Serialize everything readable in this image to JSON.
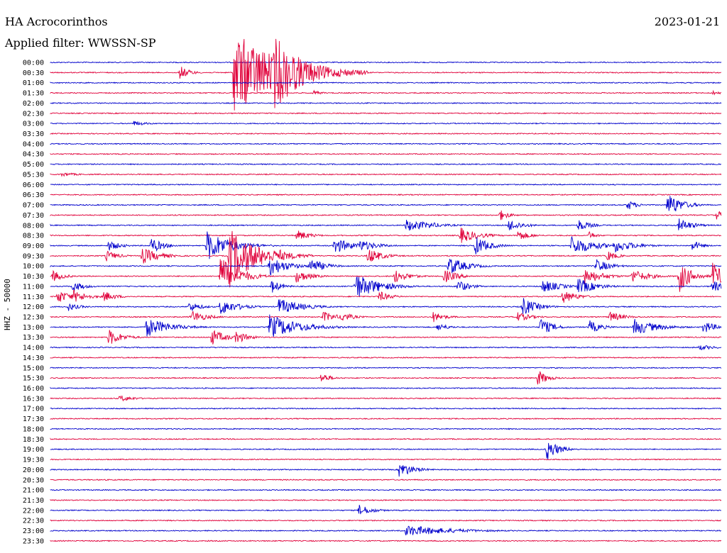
{
  "header": {
    "station": "HA Acrocorinthos",
    "date": "2023-01-21",
    "filter": "Applied filter: WWSSN-SP"
  },
  "chart_data": {
    "type": "helicorder",
    "ylabel": "HHZ - 50000",
    "colors": [
      "#0000cc",
      "#e0003a"
    ],
    "rows": [
      "00:00",
      "00:30",
      "01:00",
      "01:30",
      "02:00",
      "02:30",
      "03:00",
      "03:30",
      "04:00",
      "04:30",
      "05:00",
      "05:30",
      "06:00",
      "06:30",
      "07:00",
      "07:30",
      "08:00",
      "08:30",
      "09:00",
      "09:30",
      "10:00",
      "10:30",
      "11:00",
      "11:30",
      "12:00",
      "12:30",
      "13:00",
      "13:30",
      "14:00",
      "14:30",
      "15:00",
      "15:30",
      "16:00",
      "16:30",
      "17:00",
      "17:30",
      "18:00",
      "18:30",
      "19:00",
      "19:30",
      "20:00",
      "20:30",
      "21:00",
      "21:30",
      "22:00",
      "22:30",
      "23:00",
      "23:30"
    ],
    "minutes_per_row": 30,
    "events": [
      {
        "row": 1,
        "minute": 5.8,
        "amp": 10,
        "dur": 0.8
      },
      {
        "row": 1,
        "minute": 8.2,
        "amp": 60,
        "dur": 4.0
      },
      {
        "row": 1,
        "minute": 10.0,
        "amp": 55,
        "dur": 2.5
      },
      {
        "row": 3,
        "minute": 11.7,
        "amp": 4,
        "dur": 0.8
      },
      {
        "row": 3,
        "minute": 29.6,
        "amp": 3,
        "dur": 1.0
      },
      {
        "row": 6,
        "minute": 3.7,
        "amp": 4,
        "dur": 1.2
      },
      {
        "row": 11,
        "minute": 0.5,
        "amp": 3,
        "dur": 1.5
      },
      {
        "row": 14,
        "minute": 25.8,
        "amp": 8,
        "dur": 0.8
      },
      {
        "row": 14,
        "minute": 27.6,
        "amp": 18,
        "dur": 1.2
      },
      {
        "row": 15,
        "minute": 20.1,
        "amp": 8,
        "dur": 0.8
      },
      {
        "row": 15,
        "minute": 29.8,
        "amp": 8,
        "dur": 0.6
      },
      {
        "row": 16,
        "minute": 15.9,
        "amp": 9,
        "dur": 2.2
      },
      {
        "row": 16,
        "minute": 16.9,
        "amp": 5,
        "dur": 1.5
      },
      {
        "row": 16,
        "minute": 20.5,
        "amp": 9,
        "dur": 1.2
      },
      {
        "row": 16,
        "minute": 23.6,
        "amp": 9,
        "dur": 1.0
      },
      {
        "row": 16,
        "minute": 28.1,
        "amp": 10,
        "dur": 1.2
      },
      {
        "row": 17,
        "minute": 11.0,
        "amp": 8,
        "dur": 1.2
      },
      {
        "row": 17,
        "minute": 18.3,
        "amp": 12,
        "dur": 1.5
      },
      {
        "row": 17,
        "minute": 20.9,
        "amp": 8,
        "dur": 1.0
      },
      {
        "row": 17,
        "minute": 24.1,
        "amp": 6,
        "dur": 0.6
      },
      {
        "row": 18,
        "minute": 2.6,
        "amp": 8,
        "dur": 1.0
      },
      {
        "row": 18,
        "minute": 4.5,
        "amp": 12,
        "dur": 1.0
      },
      {
        "row": 18,
        "minute": 7.0,
        "amp": 22,
        "dur": 2.0
      },
      {
        "row": 18,
        "minute": 12.7,
        "amp": 12,
        "dur": 1.5
      },
      {
        "row": 18,
        "minute": 13.8,
        "amp": 9,
        "dur": 1.5
      },
      {
        "row": 18,
        "minute": 19.0,
        "amp": 14,
        "dur": 1.2
      },
      {
        "row": 18,
        "minute": 23.3,
        "amp": 14,
        "dur": 2.0
      },
      {
        "row": 18,
        "minute": 25.2,
        "amp": 10,
        "dur": 1.8
      },
      {
        "row": 18,
        "minute": 28.7,
        "amp": 8,
        "dur": 0.8
      },
      {
        "row": 19,
        "minute": 2.5,
        "amp": 8,
        "dur": 1.0
      },
      {
        "row": 19,
        "minute": 4.1,
        "amp": 12,
        "dur": 1.5
      },
      {
        "row": 19,
        "minute": 8.0,
        "amp": 40,
        "dur": 2.5
      },
      {
        "row": 19,
        "minute": 10.2,
        "amp": 10,
        "dur": 1.0
      },
      {
        "row": 19,
        "minute": 14.2,
        "amp": 12,
        "dur": 1.2
      },
      {
        "row": 19,
        "minute": 24.9,
        "amp": 8,
        "dur": 0.8
      },
      {
        "row": 20,
        "minute": 9.8,
        "amp": 15,
        "dur": 1.5
      },
      {
        "row": 20,
        "minute": 11.6,
        "amp": 12,
        "dur": 1.2
      },
      {
        "row": 20,
        "minute": 17.8,
        "amp": 14,
        "dur": 1.5
      },
      {
        "row": 20,
        "minute": 24.4,
        "amp": 10,
        "dur": 1.2
      },
      {
        "row": 21,
        "minute": 0.1,
        "amp": 8,
        "dur": 1.0
      },
      {
        "row": 21,
        "minute": 7.6,
        "amp": 30,
        "dur": 1.5
      },
      {
        "row": 21,
        "minute": 11.0,
        "amp": 10,
        "dur": 1.2
      },
      {
        "row": 21,
        "minute": 15.4,
        "amp": 10,
        "dur": 1.2
      },
      {
        "row": 21,
        "minute": 17.6,
        "amp": 10,
        "dur": 1.2
      },
      {
        "row": 21,
        "minute": 23.9,
        "amp": 12,
        "dur": 1.5
      },
      {
        "row": 21,
        "minute": 26.0,
        "amp": 10,
        "dur": 1.5
      },
      {
        "row": 21,
        "minute": 28.1,
        "amp": 25,
        "dur": 1.0
      },
      {
        "row": 21,
        "minute": 29.6,
        "amp": 20,
        "dur": 1.0
      },
      {
        "row": 22,
        "minute": 1.0,
        "amp": 8,
        "dur": 1.0
      },
      {
        "row": 22,
        "minute": 9.9,
        "amp": 10,
        "dur": 0.8
      },
      {
        "row": 22,
        "minute": 13.6,
        "amp": 20,
        "dur": 2.0
      },
      {
        "row": 22,
        "minute": 18.2,
        "amp": 10,
        "dur": 1.0
      },
      {
        "row": 22,
        "minute": 22.0,
        "amp": 10,
        "dur": 1.5
      },
      {
        "row": 22,
        "minute": 23.6,
        "amp": 12,
        "dur": 1.5
      },
      {
        "row": 22,
        "minute": 29.6,
        "amp": 10,
        "dur": 0.8
      },
      {
        "row": 23,
        "minute": 0.3,
        "amp": 10,
        "dur": 1.2
      },
      {
        "row": 23,
        "minute": 1.0,
        "amp": 10,
        "dur": 1.2
      },
      {
        "row": 23,
        "minute": 2.4,
        "amp": 8,
        "dur": 1.0
      },
      {
        "row": 23,
        "minute": 14.7,
        "amp": 8,
        "dur": 1.0
      },
      {
        "row": 23,
        "minute": 22.9,
        "amp": 10,
        "dur": 1.2
      },
      {
        "row": 24,
        "minute": 0.8,
        "amp": 6,
        "dur": 1.0
      },
      {
        "row": 24,
        "minute": 6.2,
        "amp": 8,
        "dur": 1.0
      },
      {
        "row": 24,
        "minute": 7.6,
        "amp": 12,
        "dur": 1.5
      },
      {
        "row": 24,
        "minute": 10.2,
        "amp": 12,
        "dur": 2.0
      },
      {
        "row": 24,
        "minute": 21.1,
        "amp": 14,
        "dur": 1.2
      },
      {
        "row": 25,
        "minute": 6.3,
        "amp": 10,
        "dur": 1.2
      },
      {
        "row": 25,
        "minute": 12.2,
        "amp": 8,
        "dur": 1.2
      },
      {
        "row": 25,
        "minute": 13.0,
        "amp": 8,
        "dur": 1.0
      },
      {
        "row": 25,
        "minute": 17.1,
        "amp": 8,
        "dur": 1.0
      },
      {
        "row": 25,
        "minute": 20.8,
        "amp": 8,
        "dur": 1.2
      },
      {
        "row": 25,
        "minute": 25.0,
        "amp": 8,
        "dur": 1.2
      },
      {
        "row": 26,
        "minute": 4.3,
        "amp": 14,
        "dur": 2.0
      },
      {
        "row": 26,
        "minute": 9.8,
        "amp": 18,
        "dur": 2.5
      },
      {
        "row": 26,
        "minute": 17.3,
        "amp": 6,
        "dur": 1.0
      },
      {
        "row": 26,
        "minute": 21.9,
        "amp": 14,
        "dur": 1.0
      },
      {
        "row": 26,
        "minute": 24.1,
        "amp": 10,
        "dur": 1.0
      },
      {
        "row": 26,
        "minute": 26.1,
        "amp": 12,
        "dur": 2.0
      },
      {
        "row": 26,
        "minute": 29.2,
        "amp": 10,
        "dur": 1.0
      },
      {
        "row": 27,
        "minute": 2.6,
        "amp": 12,
        "dur": 1.2
      },
      {
        "row": 27,
        "minute": 7.2,
        "amp": 12,
        "dur": 1.2
      },
      {
        "row": 27,
        "minute": 8.3,
        "amp": 10,
        "dur": 1.0
      },
      {
        "row": 28,
        "minute": 29.0,
        "amp": 4,
        "dur": 1.5
      },
      {
        "row": 31,
        "minute": 12.1,
        "amp": 8,
        "dur": 0.8
      },
      {
        "row": 31,
        "minute": 21.8,
        "amp": 12,
        "dur": 0.8
      },
      {
        "row": 33,
        "minute": 3.1,
        "amp": 5,
        "dur": 1.2
      },
      {
        "row": 38,
        "minute": 22.2,
        "amp": 16,
        "dur": 1.0
      },
      {
        "row": 40,
        "minute": 15.6,
        "amp": 12,
        "dur": 1.2
      },
      {
        "row": 44,
        "minute": 13.8,
        "amp": 8,
        "dur": 1.2
      },
      {
        "row": 46,
        "minute": 15.9,
        "amp": 8,
        "dur": 4.0
      }
    ]
  }
}
